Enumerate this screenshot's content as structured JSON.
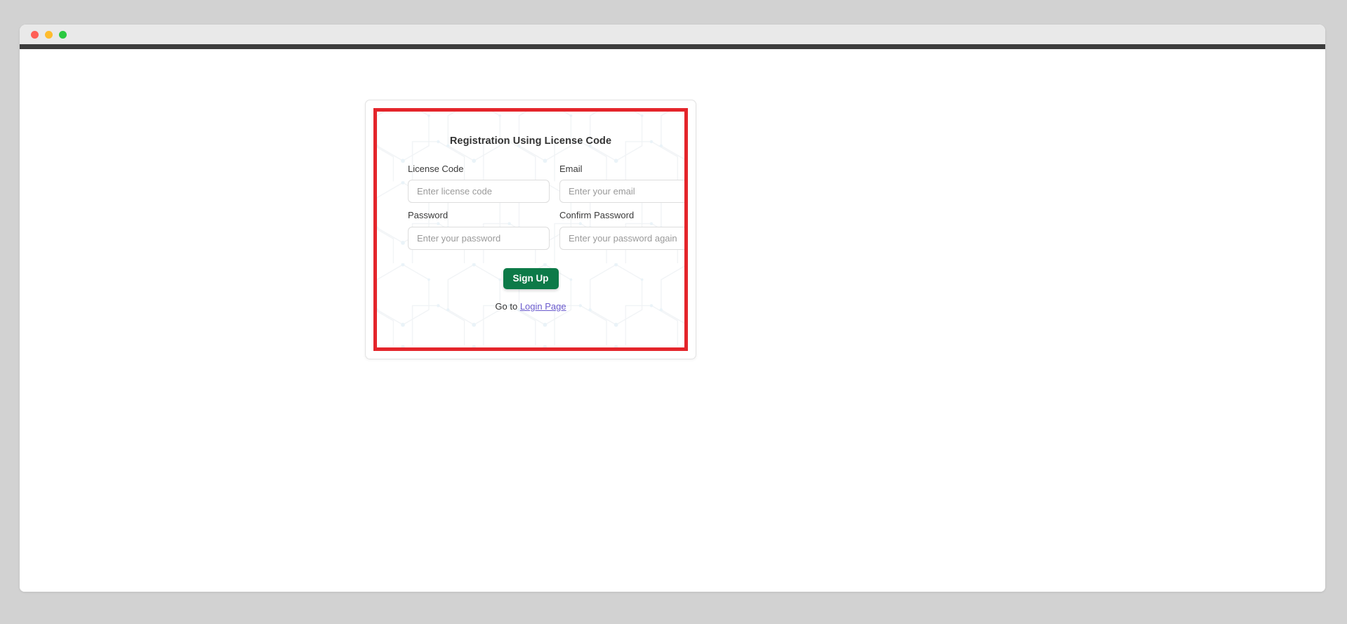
{
  "window": {
    "traffic_lights": [
      {
        "name": "close",
        "color": "#ff6057"
      },
      {
        "name": "minimize",
        "color": "#febc2e"
      },
      {
        "name": "maximize",
        "color": "#2ac940"
      }
    ]
  },
  "card": {
    "title": "Registration Using License Code",
    "highlight_color": "#e4252b",
    "fields": [
      {
        "id": "license-code",
        "label": "License Code",
        "placeholder": "Enter license code",
        "value": "",
        "type": "text"
      },
      {
        "id": "email",
        "label": "Email",
        "placeholder": "Enter your email",
        "value": "",
        "type": "text"
      },
      {
        "id": "password",
        "label": "Password",
        "placeholder": "Enter your password",
        "value": "",
        "type": "password"
      },
      {
        "id": "confirm-password",
        "label": "Confirm Password",
        "placeholder": "Enter your password again",
        "value": "",
        "type": "password"
      }
    ],
    "submit_label": "Sign Up",
    "submit_color": "#0d7a48",
    "footer": {
      "prefix": "Go to ",
      "link_label": "Login Page",
      "link_color": "#6a5acd"
    }
  },
  "background": {
    "page_color": "#d2d2d2",
    "window_color": "#ffffff",
    "titlebar_color": "#e9e9e9",
    "toolbar_strip_color": "#3c3c3c",
    "watermark": "hexagon-molecule-pattern"
  }
}
